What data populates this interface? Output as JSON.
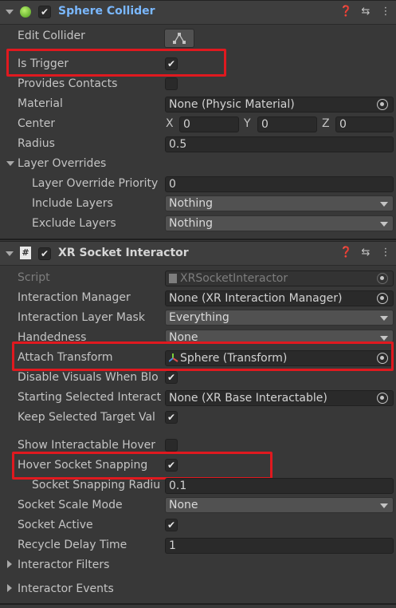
{
  "sphere_collider": {
    "title": "Sphere Collider",
    "edit_collider_label": "Edit Collider",
    "is_trigger_label": "Is Trigger",
    "is_trigger_checked": true,
    "provides_contacts_label": "Provides Contacts",
    "provides_contacts_checked": false,
    "material_label": "Material",
    "material_value": "None (Physic Material)",
    "center_label": "Center",
    "center": {
      "x_label": "X",
      "x": "0",
      "y_label": "Y",
      "y": "0",
      "z_label": "Z",
      "z": "0"
    },
    "radius_label": "Radius",
    "radius_value": "0.5",
    "layer_overrides_label": "Layer Overrides",
    "layer_override_priority_label": "Layer Override Priority",
    "layer_override_priority_value": "0",
    "include_layers_label": "Include Layers",
    "include_layers_value": "Nothing",
    "exclude_layers_label": "Exclude Layers",
    "exclude_layers_value": "Nothing"
  },
  "xr_socket": {
    "title": "XR Socket Interactor",
    "script_label": "Script",
    "script_value": "XRSocketInteractor",
    "interaction_manager_label": "Interaction Manager",
    "interaction_manager_value": "None (XR Interaction Manager)",
    "interaction_layer_mask_label": "Interaction Layer Mask",
    "interaction_layer_mask_value": "Everything",
    "handedness_label": "Handedness",
    "handedness_value": "None",
    "attach_transform_label": "Attach Transform",
    "attach_transform_value": "Sphere (Transform)",
    "disable_visuals_label": "Disable Visuals When Blo",
    "disable_visuals_checked": true,
    "starting_selected_label": "Starting Selected Interact",
    "starting_selected_value": "None (XR Base Interactable)",
    "keep_selected_label": "Keep Selected Target Val",
    "keep_selected_checked": true,
    "show_hover_label": "Show Interactable Hover",
    "show_hover_checked": false,
    "hover_snapping_label": "Hover Socket Snapping",
    "hover_snapping_checked": true,
    "snapping_radius_label": "Socket Snapping Radiu",
    "snapping_radius_value": "0.1",
    "scale_mode_label": "Socket Scale Mode",
    "scale_mode_value": "None",
    "socket_active_label": "Socket Active",
    "socket_active_checked": true,
    "recycle_delay_label": "Recycle Delay Time",
    "recycle_delay_value": "1",
    "interactor_filters_label": "Interactor Filters",
    "interactor_events_label": "Interactor Events"
  },
  "check_glyph": "✔",
  "colors": {
    "highlight": "#e0191f",
    "title_blue": "#7ab8ff"
  }
}
